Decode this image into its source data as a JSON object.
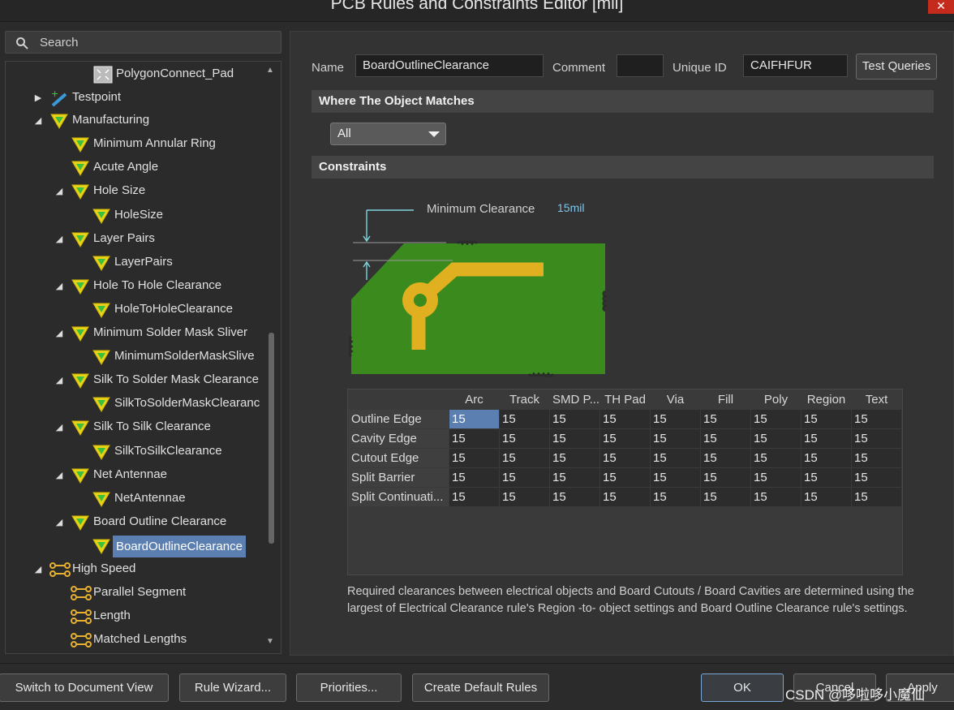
{
  "window": {
    "title": "PCB Rules and Constraints Editor [mil]",
    "close": "✕"
  },
  "search": {
    "placeholder": "Search"
  },
  "tree": [
    {
      "id": "polygonconnect-pad",
      "label": "PolygonConnect_Pad",
      "icon": "polygon-rule-icon",
      "arrow": ""
    },
    {
      "id": "testpoint",
      "label": "Testpoint",
      "icon": "testpoint-icon",
      "arrow": "▶"
    },
    {
      "id": "manufacturing",
      "label": "Manufacturing",
      "icon": "rule-funnel-icon",
      "arrow": "◢"
    },
    {
      "id": "minimum-annular-ring",
      "label": "Minimum Annular Ring",
      "icon": "rule-funnel-icon",
      "arrow": ""
    },
    {
      "id": "acute-angle",
      "label": "Acute Angle",
      "icon": "rule-funnel-icon",
      "arrow": ""
    },
    {
      "id": "hole-size",
      "label": "Hole Size",
      "icon": "rule-funnel-icon",
      "arrow": "◢"
    },
    {
      "id": "holesize",
      "label": "HoleSize",
      "icon": "rule-funnel-icon",
      "arrow": ""
    },
    {
      "id": "layer-pairs",
      "label": "Layer Pairs",
      "icon": "rule-funnel-icon",
      "arrow": "◢"
    },
    {
      "id": "layerpairs",
      "label": "LayerPairs",
      "icon": "rule-funnel-icon",
      "arrow": ""
    },
    {
      "id": "hole-to-hole-clearance",
      "label": "Hole To Hole Clearance",
      "icon": "rule-funnel-icon",
      "arrow": "◢"
    },
    {
      "id": "holetoholeclearance",
      "label": "HoleToHoleClearance",
      "icon": "rule-funnel-icon",
      "arrow": ""
    },
    {
      "id": "minimum-solder-mask-sliver",
      "label": "Minimum Solder Mask Sliver",
      "icon": "rule-funnel-icon",
      "arrow": "◢"
    },
    {
      "id": "minimumsoldermasksliver",
      "label": "MinimumSolderMaskSlive",
      "icon": "rule-funnel-icon",
      "arrow": ""
    },
    {
      "id": "silk-to-solder-mask-clearance",
      "label": "Silk To Solder Mask Clearance",
      "icon": "rule-funnel-icon",
      "arrow": "◢"
    },
    {
      "id": "silktosoldermaskclearance",
      "label": "SilkToSolderMaskClearanc",
      "icon": "rule-funnel-icon",
      "arrow": ""
    },
    {
      "id": "silk-to-silk-clearance",
      "label": "Silk To Silk Clearance",
      "icon": "rule-funnel-icon",
      "arrow": "◢"
    },
    {
      "id": "silktosilkclearance",
      "label": "SilkToSilkClearance",
      "icon": "rule-funnel-icon",
      "arrow": ""
    },
    {
      "id": "net-antennae",
      "label": "Net Antennae",
      "icon": "rule-funnel-icon",
      "arrow": "◢"
    },
    {
      "id": "netantennae",
      "label": "NetAntennae",
      "icon": "rule-funnel-icon",
      "arrow": ""
    },
    {
      "id": "board-outline-clearance",
      "label": "Board Outline Clearance",
      "icon": "rule-funnel-icon",
      "arrow": "◢"
    },
    {
      "id": "boardoutlineclearance",
      "label": "BoardOutlineClearance",
      "icon": "rule-funnel-icon",
      "arrow": "",
      "selected": true
    },
    {
      "id": "high-speed",
      "label": "High Speed",
      "icon": "high-speed-icon",
      "arrow": "◢"
    },
    {
      "id": "parallel-segment",
      "label": "Parallel Segment",
      "icon": "high-speed-icon",
      "arrow": ""
    },
    {
      "id": "length",
      "label": "Length",
      "icon": "high-speed-icon",
      "arrow": ""
    },
    {
      "id": "matched-lengths",
      "label": "Matched Lengths",
      "icon": "high-speed-icon",
      "arrow": ""
    }
  ],
  "rule": {
    "name_label": "Name",
    "name_value": "BoardOutlineClearance",
    "comment_label": "Comment",
    "comment_value": "",
    "uid_label": "Unique ID",
    "uid_value": "CAIFHFUR",
    "test_queries": "Test Queries"
  },
  "matches": {
    "header": "Where The Object Matches",
    "dropdown": "All"
  },
  "constraints": {
    "header": "Constraints",
    "min_clearance_label": "Minimum Clearance",
    "min_clearance_value": "15mil",
    "columns": [
      "",
      "Arc",
      "Track",
      "SMD P...",
      "TH Pad",
      "Via",
      "Fill",
      "Poly",
      "Region",
      "Text"
    ],
    "rows": [
      {
        "name": "Outline Edge",
        "values": [
          "15",
          "15",
          "15",
          "15",
          "15",
          "15",
          "15",
          "15",
          "15"
        ]
      },
      {
        "name": "Cavity Edge",
        "values": [
          "15",
          "15",
          "15",
          "15",
          "15",
          "15",
          "15",
          "15",
          "15"
        ]
      },
      {
        "name": "Cutout Edge",
        "values": [
          "15",
          "15",
          "15",
          "15",
          "15",
          "15",
          "15",
          "15",
          "15"
        ]
      },
      {
        "name": "Split Barrier",
        "values": [
          "15",
          "15",
          "15",
          "15",
          "15",
          "15",
          "15",
          "15",
          "15"
        ]
      },
      {
        "name": "Split Continuati...",
        "values": [
          "15",
          "15",
          "15",
          "15",
          "15",
          "15",
          "15",
          "15",
          "15"
        ]
      }
    ],
    "description": "Required clearances between electrical objects and Board Cutouts / Board Cavities are determined using the largest of Electrical Clearance rule's Region -to- object settings and Board Outline Clearance rule's settings."
  },
  "bottom": {
    "switch_view": "Switch to Document View",
    "rule_wizard": "Rule Wizard...",
    "priorities": "Priorities...",
    "create_default": "Create Default Rules",
    "ok": "OK",
    "cancel": "Cancel",
    "apply": "Apply"
  },
  "watermark": "CSDN @哆啦哆小魔仙",
  "colors": {
    "accent": "#5b7fb0",
    "board": "#3a8a1e",
    "copper": "#e0b020",
    "dim_line": "#7fd6e0"
  }
}
